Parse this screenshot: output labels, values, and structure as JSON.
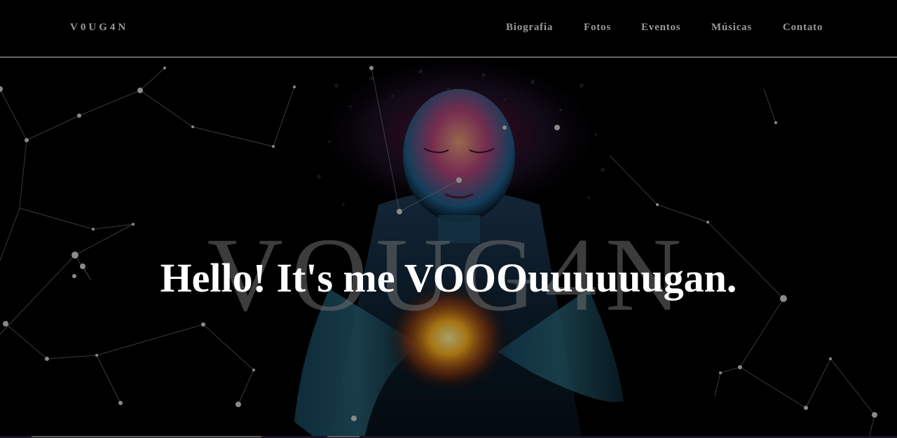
{
  "nav": {
    "brand": "V0UG4N",
    "links": [
      {
        "label": "Biografia"
      },
      {
        "label": "Fotos"
      },
      {
        "label": "Eventos"
      },
      {
        "label": "Músicas"
      },
      {
        "label": "Contato"
      }
    ]
  },
  "hero": {
    "title": "Hello! It's me VOOOuuuuuugan.",
    "watermark": "VOUG4N"
  },
  "colors": {
    "background": "#000000",
    "nav_text": "#9a9a9a",
    "title_text": "#ffffff",
    "nav_border": "#bdbdbd"
  }
}
